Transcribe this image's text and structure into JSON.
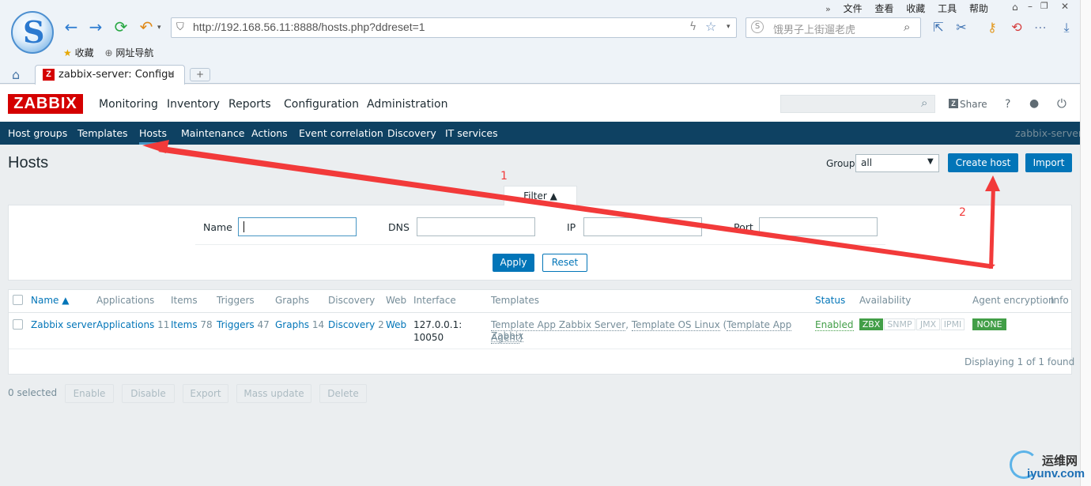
{
  "browser": {
    "address": "http://192.168.56.11:8888/hosts.php?ddreset=1",
    "search_placeholder": "饿男子上街遛老虎",
    "menu": [
      "文件",
      "查看",
      "收藏",
      "工具",
      "帮助"
    ],
    "bookmarks": [
      "收藏",
      "网址导航"
    ],
    "tab_title": "zabbix-server: Configu",
    "tab_favicon": "Z"
  },
  "zabbix": {
    "logo": "ZABBIX",
    "main_nav": [
      "Monitoring",
      "Inventory",
      "Reports",
      "Configuration",
      "Administration"
    ],
    "share": "Share",
    "help": "?",
    "sub_nav": [
      "Host groups",
      "Templates",
      "Hosts",
      "Maintenance",
      "Actions",
      "Event correlation",
      "Discovery",
      "IT services"
    ],
    "server": "zabbix-server"
  },
  "page": {
    "title": "Hosts",
    "group_label": "Group",
    "group_value": "all",
    "create_host": "Create host",
    "import": "Import"
  },
  "filter": {
    "tab": "Filter ▲",
    "labels": {
      "name": "Name",
      "dns": "DNS",
      "ip": "IP",
      "port": "Port"
    },
    "apply": "Apply",
    "reset": "Reset"
  },
  "table": {
    "headers": [
      "Name ▲",
      "Applications",
      "Items",
      "Triggers",
      "Graphs",
      "Discovery",
      "Web",
      "Interface",
      "Templates",
      "Status",
      "Availability",
      "Agent encryption",
      "Info"
    ],
    "row": {
      "name": "Zabbix server",
      "applications": "Applications",
      "applications_count": "11",
      "items": "Items",
      "items_count": "78",
      "triggers": "Triggers",
      "triggers_count": "47",
      "graphs": "Graphs",
      "graphs_count": "14",
      "discovery": "Discovery",
      "discovery_count": "2",
      "web": "Web",
      "interface_line1": "127.0.0.1:",
      "interface_line2": "10050",
      "template1": "Template App Zabbix Server",
      "template2": "Template OS Linux",
      "template3a": "Template App Zabbix",
      "template3b": "Agent",
      "status": "Enabled",
      "availability": [
        "ZBX",
        "SNMP",
        "JMX",
        "IPMI"
      ],
      "encryption": "NONE"
    },
    "footer": "Displaying 1 of 1 found"
  },
  "actions": {
    "selected": "0 selected",
    "buttons": [
      "Enable",
      "Disable",
      "Export",
      "Mass update",
      "Delete"
    ]
  },
  "annotations": {
    "arrow1_label": "1",
    "arrow2_label": "2"
  },
  "watermark": {
    "text": "运维网",
    "url": "iyunv.com"
  },
  "colors": {
    "zabbix_red": "#d40000",
    "nav_dark": "#0e4162",
    "primary_blue": "#0275b8",
    "enabled_green": "#429e47",
    "arrow_red": "#f23a3a"
  }
}
